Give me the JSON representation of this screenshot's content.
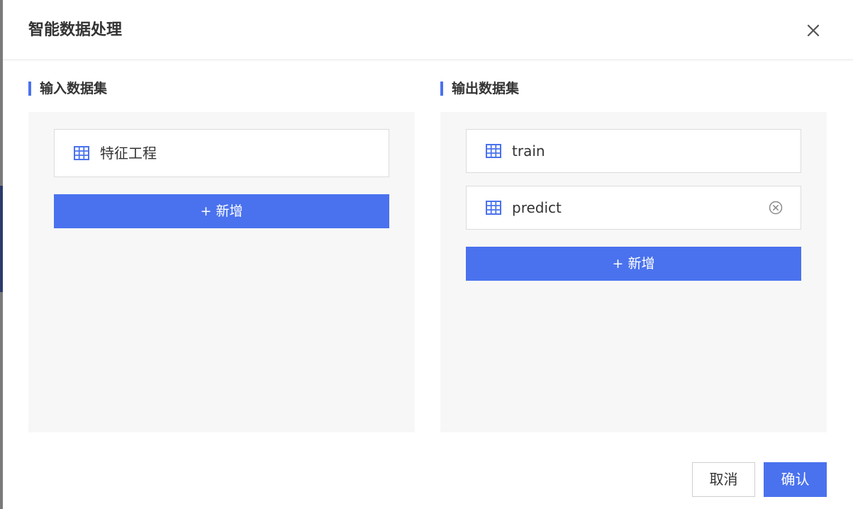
{
  "dialog": {
    "title": "智能数据处理",
    "close_icon": "close-icon"
  },
  "input_section": {
    "heading": "输入数据集",
    "items": [
      {
        "label": "特征工程",
        "icon": "table-icon"
      }
    ],
    "add_label": "+ 新增"
  },
  "output_section": {
    "heading": "输出数据集",
    "items": [
      {
        "label": "train",
        "icon": "table-icon"
      },
      {
        "label": "predict",
        "icon": "table-icon",
        "remove_icon": "remove-circle-icon"
      }
    ],
    "add_label": "+ 新增"
  },
  "footer": {
    "cancel_label": "取消",
    "confirm_label": "确认"
  },
  "colors": {
    "accent": "#4a72ee",
    "panel_bg": "#f7f7f7",
    "border": "#dcdcdc",
    "text": "#333333"
  }
}
